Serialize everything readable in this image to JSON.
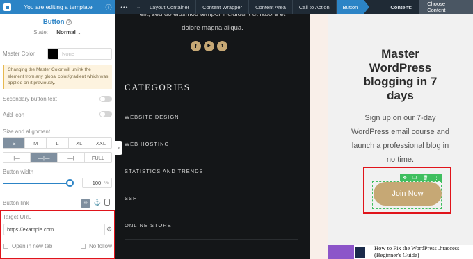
{
  "panel": {
    "header_title": "You are editing a template",
    "element_title": "Button",
    "state_label": "State:",
    "state_value": "Normal",
    "master_color_label": "Master Color",
    "master_color_placeholder": "None",
    "master_color_swatch": "#000000",
    "warning_text": "Changing the Master Color will unlink the element from any global color/gradient which was applied on it previously.",
    "secondary_text_label": "Secondary button text",
    "add_icon_label": "Add icon",
    "size_label": "Size and alignment",
    "sizes": [
      "S",
      "M",
      "L",
      "XL",
      "XXL"
    ],
    "active_size": "S",
    "align_full": "FULL",
    "width_label": "Button width",
    "width_value": "100",
    "width_unit": "%",
    "width_percent": 100,
    "link_label": "Button link",
    "target_url_label": "Target URL",
    "target_url_value": "https://example.com",
    "new_tab_label": "Open in new tab",
    "no_follow_label": "No follow"
  },
  "toolbar": {
    "crumbs": [
      "Layout Container",
      "Content Wrapper",
      "Content Area",
      "Call to Action",
      "Button"
    ],
    "content_label": "Content:",
    "choose_label": "Choose Content"
  },
  "dark": {
    "lorem": [
      "elit, sed do eiusmod tempor incididunt ut labore et",
      "dolore magna aliqua."
    ],
    "categories_title": "CATEGORIES",
    "categories": [
      "WEBSITE DESIGN",
      "WEB HOSTING",
      "STATISTICS AND TRENDS",
      "SSH",
      "ONLINE STORE"
    ]
  },
  "cta": {
    "title_lines": [
      "Master",
      "WordPress",
      "blogging in 7",
      "days"
    ],
    "body_lines": [
      "Sign up on our 7-day",
      "WordPress email course and",
      "launch a professional blog in",
      "no time."
    ],
    "button_label": "Join Now"
  },
  "post": {
    "title_lines": [
      "How to Fix the WordPress .htaccess",
      "(Beginner's Guide)"
    ]
  },
  "colors": {
    "accent": "#2c84c6",
    "button_gold": "#c6a875",
    "highlight_red": "#e0141b",
    "toolbar_green": "#3fbf5f"
  }
}
